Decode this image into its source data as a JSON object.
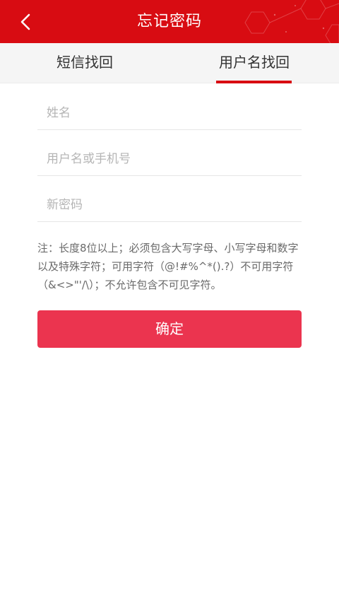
{
  "header": {
    "title": "忘记密码",
    "back_icon": "chevron-left-icon"
  },
  "tabs": [
    {
      "label": "短信找回",
      "active": false
    },
    {
      "label": "用户名找回",
      "active": true
    }
  ],
  "form": {
    "name_placeholder": "姓名",
    "username_placeholder": "用户名或手机号",
    "password_placeholder": "新密码"
  },
  "note": "注：长度8位以上；必须包含大写字母、小写字母和数字以及特殊字符；可用字符（@!#%^*().?）不可用字符（&<>\"'/\\）；不允许包含不可见字符。",
  "confirm_label": "确定",
  "colors": {
    "header_bg": "#d80c12",
    "accent": "#d80c12",
    "button_bg": "#eb344f"
  }
}
